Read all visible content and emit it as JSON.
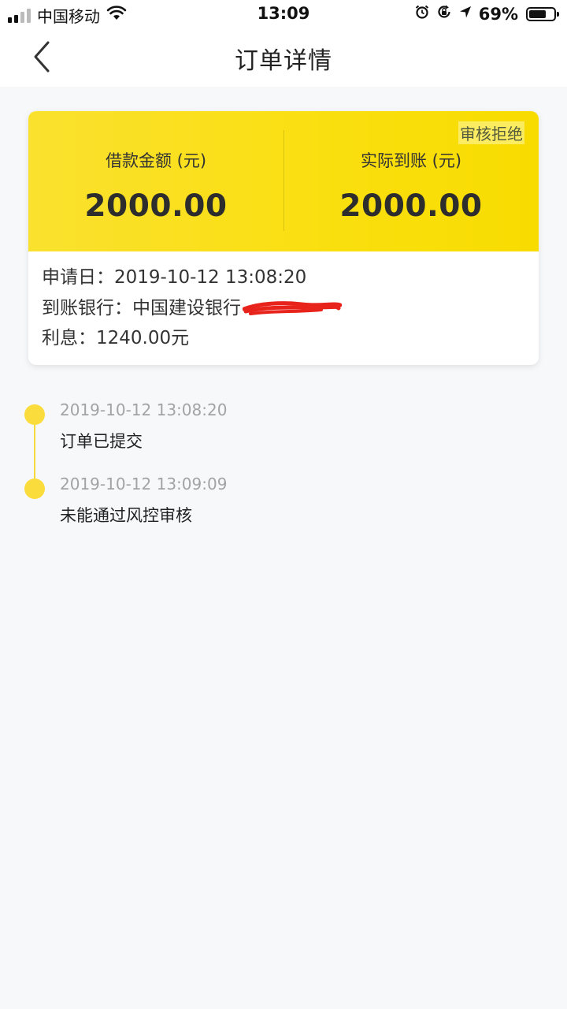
{
  "status_bar": {
    "carrier": "中国移动",
    "time": "13:09",
    "battery_percent": "69%",
    "battery_level": 0.69,
    "icons": [
      "signal-icon",
      "wifi-icon",
      "alarm-icon",
      "rotation-lock-icon",
      "location-icon",
      "battery-icon"
    ]
  },
  "nav": {
    "title": "订单详情",
    "back_icon": "chevron-left-icon"
  },
  "card": {
    "status_badge": "审核拒绝",
    "loan_amount_label": "借款金额 (元)",
    "loan_amount_value": "2000.00",
    "received_label": "实际到账 (元)",
    "received_value": "2000.00",
    "apply_date_label": "申请日：",
    "apply_date_value": "2019-10-12 13:08:20",
    "bank_label": "到账银行：",
    "bank_value": "中国建设银行",
    "interest_label": "利息：",
    "interest_value": "1240.00元",
    "colors": {
      "accent": "#fadf0f",
      "redaction": "#e8231c"
    }
  },
  "timeline": [
    {
      "time": "2019-10-12 13:08:20",
      "text": "订单已提交"
    },
    {
      "time": "2019-10-12 13:09:09",
      "text": "未能通过风控审核"
    }
  ]
}
